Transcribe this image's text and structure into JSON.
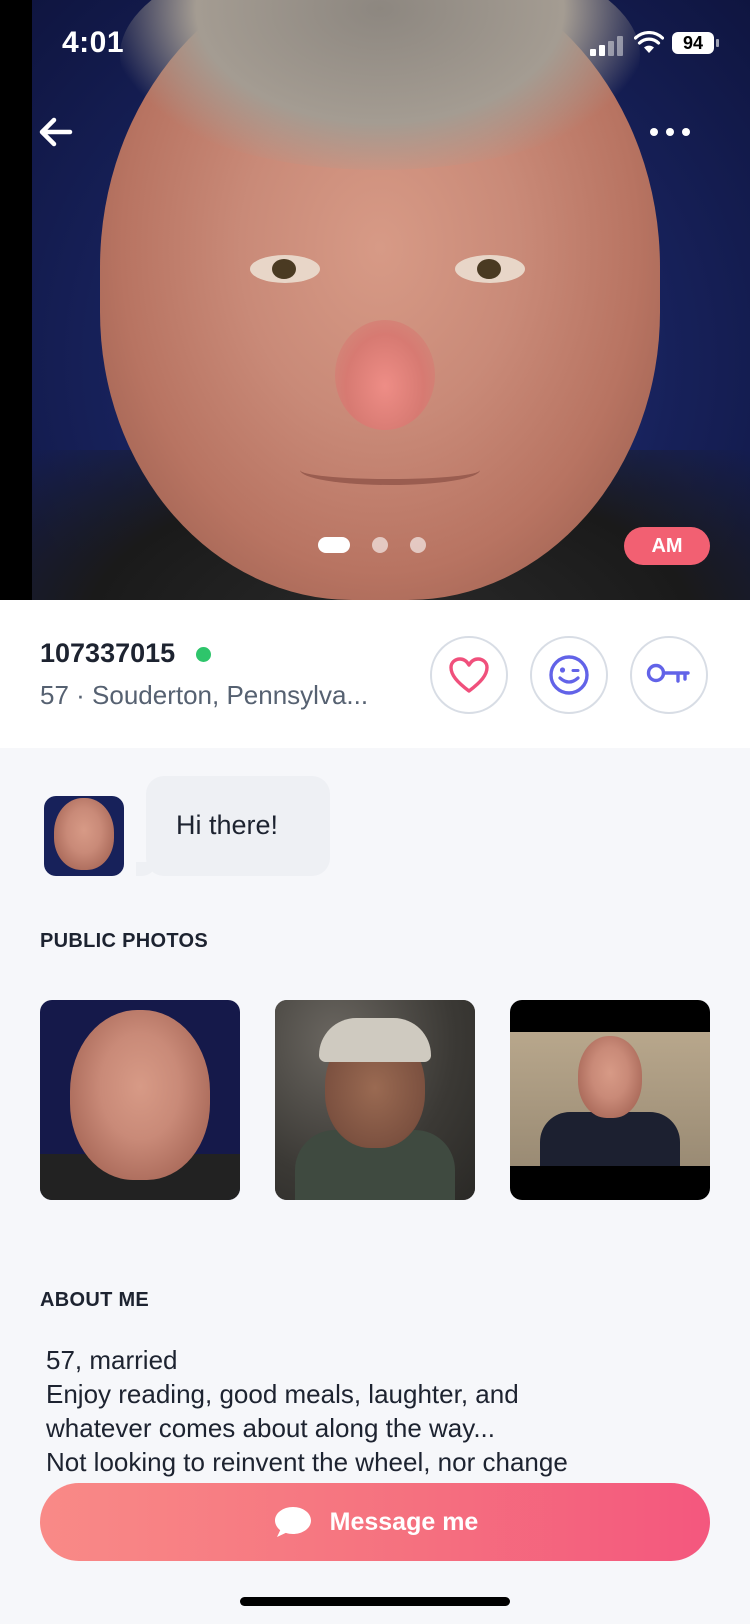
{
  "status_bar": {
    "time": "4:01",
    "battery": "94"
  },
  "hero": {
    "badge": "AM"
  },
  "profile": {
    "username": "107337015",
    "location": "57 · Souderton, Pennsylva..."
  },
  "greeting": {
    "message": "Hi there!"
  },
  "sections": {
    "public_photos_title": "PUBLIC PHOTOS",
    "about_title": "ABOUT ME"
  },
  "about": {
    "lines": [
      "57, married",
      "Enjoy reading, good meals, laughter, and",
      "whatever comes about along the way...",
      "Not looking to reinvent the wheel, nor change"
    ]
  },
  "cta": {
    "label": "Message me"
  },
  "icons": {
    "back": "arrow-left-icon",
    "more": "more-horizontal-icon",
    "like": "heart-icon",
    "wink": "smiley-wink-icon",
    "key": "key-icon",
    "message": "chat-bubble-icon"
  },
  "colors": {
    "accent": "#f4577e",
    "online": "#2ec56b",
    "like": "#f0507c",
    "wink": "#6263e8"
  }
}
